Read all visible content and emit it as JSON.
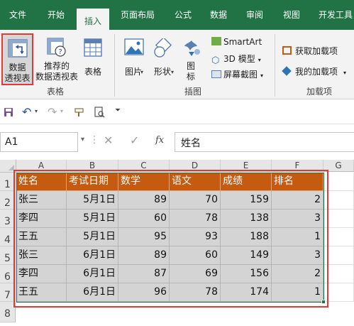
{
  "tabs": [
    "文件",
    "开始",
    "插入",
    "页面布局",
    "公式",
    "数据",
    "审阅",
    "视图",
    "开发工具"
  ],
  "active_tab": "插入",
  "ribbon": {
    "pivot": {
      "line1": "数据",
      "line2": "透视表"
    },
    "recommended": {
      "line1": "推荐的",
      "line2": "数据透视表"
    },
    "table": "表格",
    "group_tables": "表格",
    "picture": "图片",
    "shapes": "形状",
    "icons": {
      "line1": "图",
      "line2": "标"
    },
    "smartart": "SmartArt",
    "model3d": "3D 模型",
    "screenshot": "屏幕截图",
    "group_illustrations": "插图",
    "get_addins": "获取加载项",
    "my_addins": "我的加载项",
    "group_addins": "加载项"
  },
  "namebox": "A1",
  "formula_value": "姓名",
  "fx_label": "fx",
  "columns": [
    "A",
    "B",
    "C",
    "D",
    "E",
    "F",
    "G"
  ],
  "rows": [
    "1",
    "2",
    "3",
    "4",
    "5",
    "6",
    "7",
    "8"
  ],
  "table": {
    "headers": [
      "姓名",
      "考试日期",
      "数学",
      "语文",
      "成绩",
      "排名"
    ],
    "rows": [
      [
        "张三",
        "5月1日",
        "89",
        "70",
        "159",
        "2"
      ],
      [
        "李四",
        "5月1日",
        "60",
        "78",
        "138",
        "3"
      ],
      [
        "王五",
        "5月1日",
        "95",
        "93",
        "188",
        "1"
      ],
      [
        "张三",
        "6月1日",
        "89",
        "60",
        "149",
        "3"
      ],
      [
        "李四",
        "6月1日",
        "87",
        "69",
        "156",
        "2"
      ],
      [
        "王五",
        "6月1日",
        "96",
        "78",
        "174",
        "1"
      ]
    ]
  },
  "colors": {
    "ribbon_green": "#217346",
    "header_orange": "#c55a11",
    "selection_red": "#e53935",
    "cell_gray": "#d4d4d4"
  }
}
